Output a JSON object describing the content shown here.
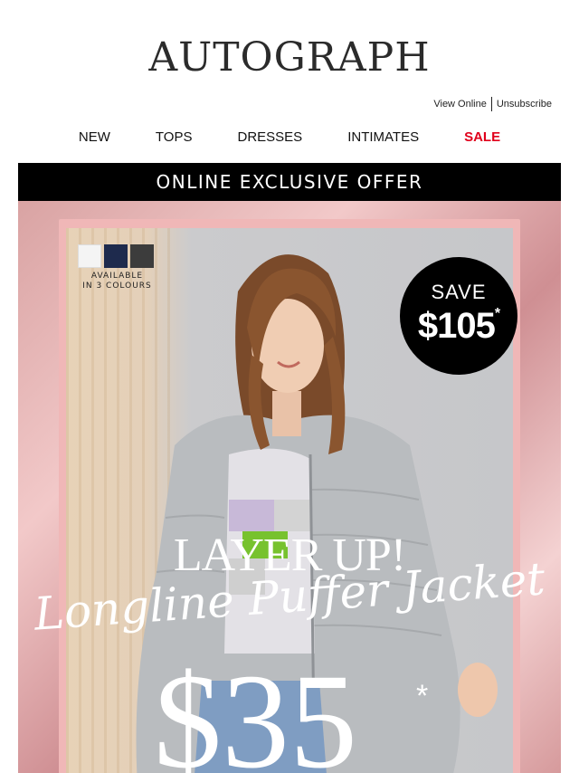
{
  "header": {
    "logo": "AUTOGRAPH",
    "view_online": "View Online",
    "unsubscribe": "Unsubscribe"
  },
  "nav": {
    "items": [
      "NEW",
      "TOPS",
      "DRESSES",
      "INTIMATES",
      "SALE"
    ],
    "sale_color": "#e0001b"
  },
  "banner": {
    "text": "ONLINE EXCLUSIVE OFFER"
  },
  "hero": {
    "swatches": [
      "white",
      "navy",
      "charcoal"
    ],
    "availability_line1": "AVAILABLE",
    "availability_line2": "IN 3 COLOURS",
    "save_label": "SAVE",
    "save_amount": "$105",
    "save_asterisk": "*",
    "headline": "LAYER UP!",
    "product_name": "Longline Puffer Jacket",
    "price": "$35",
    "price_asterisk": "*"
  }
}
